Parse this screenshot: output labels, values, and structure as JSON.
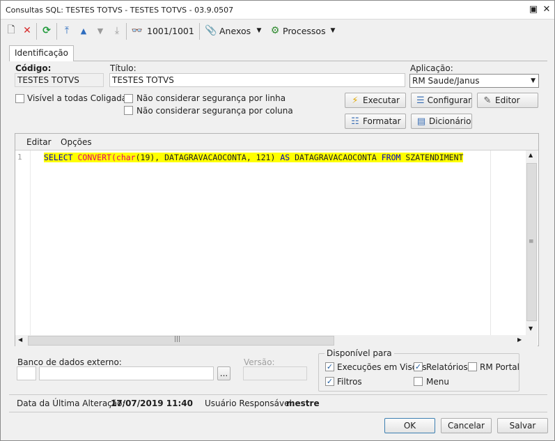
{
  "window": {
    "title": "Consultas SQL: TESTES TOTVS - TESTES TOTVS - 03.9.0507"
  },
  "toolbar": {
    "record_counter": "1001/1001",
    "anexos_label": "Anexos",
    "processos_label": "Processos"
  },
  "tabs": [
    {
      "label": "Identificação"
    }
  ],
  "form": {
    "codigo_label": "Código:",
    "codigo_value": "TESTES TOTVS",
    "titulo_label": "Título:",
    "titulo_value": "TESTES TOTVS",
    "aplicacao_label": "Aplicação:",
    "aplicacao_value": "RM Saude/Janus",
    "visivel_label": "Visível a todas Coligadas",
    "seg_linha_label": "Não considerar segurança por linha",
    "seg_coluna_label": "Não considerar segurança por coluna"
  },
  "actions": {
    "executar": "Executar",
    "configurar": "Configurar",
    "editor": "Editor",
    "formatar": "Formatar",
    "dicionario": "Dicionário"
  },
  "editor": {
    "menu": [
      "Editar",
      "Opções"
    ],
    "line_number": "1",
    "code": [
      {
        "t": "SELECT",
        "c": "kw"
      },
      {
        "t": " ",
        "c": ""
      },
      {
        "t": "CONVERT",
        "c": "fn"
      },
      {
        "t": "(",
        "c": "fn"
      },
      {
        "t": "char",
        "c": "fn"
      },
      {
        "t": "(19), DATAGRAVACAOCONTA, 121) ",
        "c": ""
      },
      {
        "t": "AS",
        "c": "kw"
      },
      {
        "t": " DATAGRAVACAOCONTA ",
        "c": ""
      },
      {
        "t": "FROM",
        "c": "kw"
      },
      {
        "t": " SZATENDIMENT",
        "c": ""
      }
    ]
  },
  "external": {
    "banco_label": "Banco de dados externo:",
    "versao_label": "Versão:",
    "browse_label": "..."
  },
  "disponivel": {
    "title": "Disponível para",
    "execucoes": "Execuções em Visões",
    "relatorios": "Relatórios",
    "rmportal": "RM Portal",
    "filtros": "Filtros",
    "menu": "Menu"
  },
  "status": {
    "data_label": "Data da Última Alteração:",
    "data_value": "17/07/2019 11:40",
    "usuario_label": "Usuário Responsável:",
    "usuario_value": "mestre"
  },
  "dialog_buttons": {
    "ok": "OK",
    "cancelar": "Cancelar",
    "salvar": "Salvar"
  }
}
